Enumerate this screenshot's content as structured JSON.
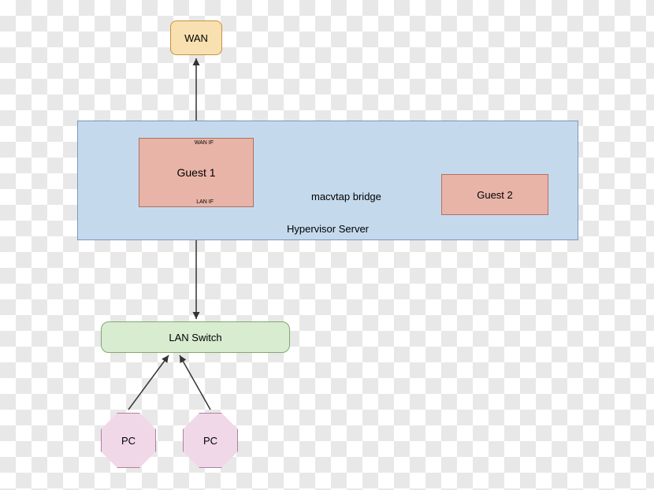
{
  "nodes": {
    "wan": {
      "label": "WAN"
    },
    "hypervisor": {
      "label": "Hypervisor Server"
    },
    "guest1": {
      "label": "Guest 1",
      "wan_if": "WAN IF",
      "lan_if": "LAN IF"
    },
    "guest2": {
      "label": "Guest 2"
    },
    "lan_switch": {
      "label": "LAN Switch"
    },
    "pc1": {
      "label": "PC"
    },
    "pc2": {
      "label": "PC"
    }
  },
  "edges": {
    "macvtap": {
      "label": "macvtap bridge"
    }
  }
}
